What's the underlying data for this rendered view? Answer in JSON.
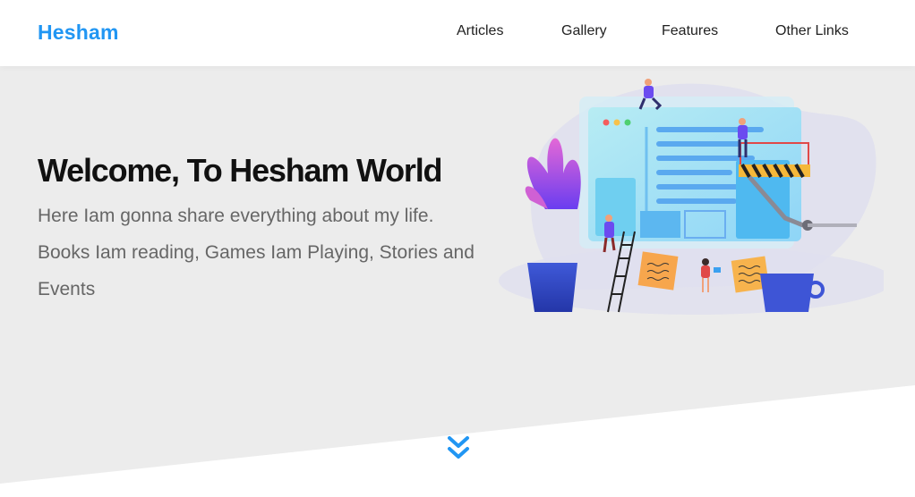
{
  "header": {
    "logo": "Hesham",
    "nav": [
      "Articles",
      "Gallery",
      "Features",
      "Other Links"
    ]
  },
  "intro": {
    "title": "Welcome, To Hesham World",
    "description": "Here Iam gonna share everything about my life. Books Iam reading, Games Iam Playing, Stories and Events"
  },
  "colors": {
    "brand": "#2196f3",
    "landing_bg": "#ececec",
    "heading": "#111111",
    "body_text": "#666666"
  },
  "icons": {
    "scroll_down": "double-chevron-down-icon",
    "illustration": "web-development-team-illustration"
  }
}
